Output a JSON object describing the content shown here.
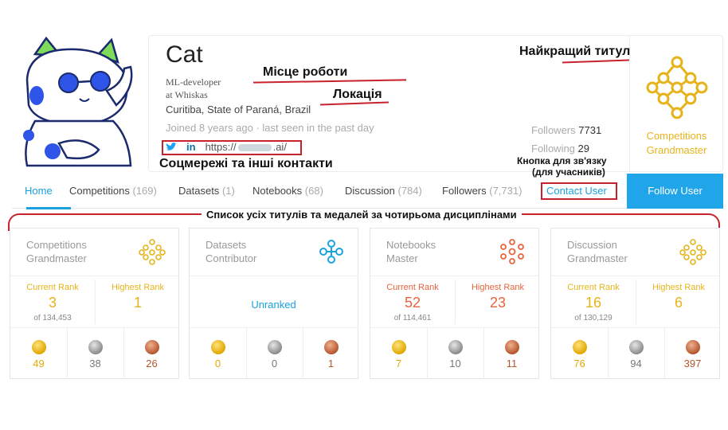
{
  "profile": {
    "name": "Cat",
    "workplace_line1": "ML-developer",
    "workplace_line2": "at Whiskas",
    "location": "Curitiba, State of Paraná, Brazil",
    "joined": "Joined 8 years ago · last seen in the past day",
    "social_twitter": "t",
    "social_linkedin": "in",
    "website_prefix": "https://",
    "website_suffix": ".ai/",
    "followers_label": "Followers",
    "followers_value": "7731",
    "following_label": "Following",
    "following_value": "29",
    "best_title": "Competitions Grandmaster"
  },
  "annotations": {
    "workplace": "Місце роботи",
    "location": "Локація",
    "best_title": "Найкращий титул",
    "socials": "Соцмережі та інші контакти",
    "contact_line1": "Кнопка для зв'язку",
    "contact_line2": "(для учасників)",
    "medals": "Список усіх титулів та медалей за чотирьома дисциплінами"
  },
  "nav": {
    "home": "Home",
    "competitions": "Competitions",
    "competitions_count": "(169)",
    "datasets": "Datasets",
    "datasets_count": "(1)",
    "notebooks": "Notebooks",
    "notebooks_count": "(68)",
    "discussion": "Discussion",
    "discussion_count": "(784)",
    "followers": "Followers",
    "followers_count": "(7,731)",
    "contact": "Contact User",
    "follow": "Follow User"
  },
  "cards": [
    {
      "title_line1": "Competitions",
      "title_line2": "Grandmaster",
      "icon_color": "#e6b41a",
      "current_label": "Current Rank",
      "current": "3",
      "of": "of 134,453",
      "highest_label": "Highest Rank",
      "highest": "1",
      "gold": "49",
      "silver": "38",
      "bronze": "26"
    },
    {
      "title_line1": "Datasets",
      "title_line2": "Contributor",
      "icon_color": "#1aa1e0",
      "unranked": "Unranked",
      "gold": "0",
      "silver": "0",
      "bronze": "1"
    },
    {
      "title_line1": "Notebooks",
      "title_line2": "Master",
      "icon_color": "#e8643c",
      "current_label": "Current Rank",
      "current": "52",
      "of": "of 114,461",
      "highest_label": "Highest Rank",
      "highest": "23",
      "gold": "7",
      "silver": "10",
      "bronze": "11"
    },
    {
      "title_line1": "Discussion",
      "title_line2": "Grandmaster",
      "icon_color": "#e6b41a",
      "current_label": "Current Rank",
      "current": "16",
      "of": "of 130,129",
      "highest_label": "Highest Rank",
      "highest": "6",
      "gold": "76",
      "silver": "94",
      "bronze": "397"
    }
  ]
}
